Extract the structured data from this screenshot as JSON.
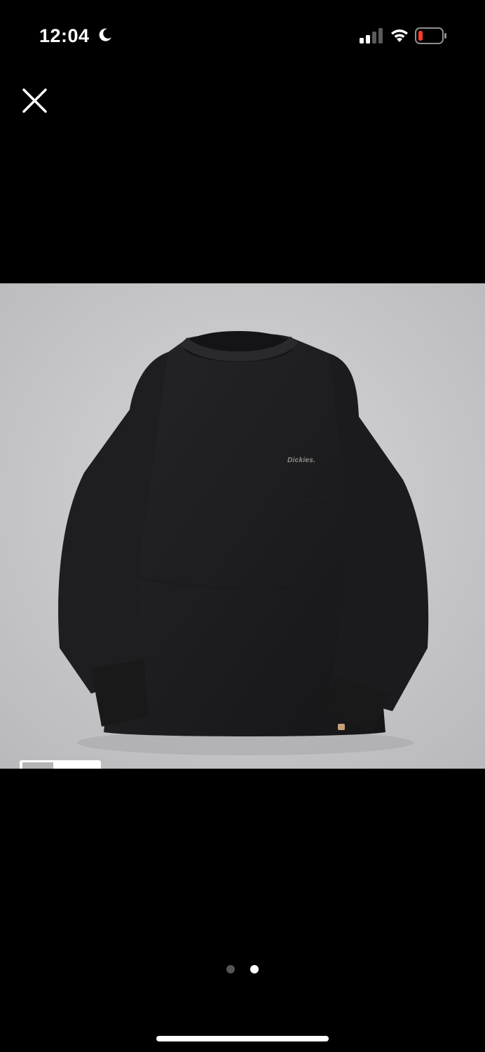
{
  "status": {
    "time": "12:04",
    "moon_icon": "moon-icon",
    "signal_icon": "cellular-signal-icon",
    "wifi_icon": "wifi-icon",
    "battery_icon": "battery-low-icon",
    "battery_color": "#ff3b30"
  },
  "toolbar": {
    "close_icon": "close-icon"
  },
  "product_image": {
    "brand_logo_text": "Dickies.",
    "background_color": "#c8c8ca",
    "garment_color": "#1c1c1e"
  },
  "pager": {
    "total": 2,
    "active_index": 1
  }
}
